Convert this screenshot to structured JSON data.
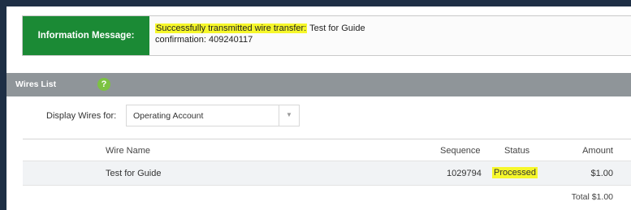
{
  "info": {
    "label": "Information Message:",
    "message_highlight": "Successfully transmitted wire transfer:",
    "message_rest": " Test for Guide",
    "confirmation": "confirmation: 409240117",
    "label_bg": "#1b8a35",
    "highlight_color": "#f6f72a"
  },
  "wires": {
    "title": "Wires List",
    "help_icon": "question-circle-icon",
    "filter_label": "Display Wires for:",
    "account_selected": "Operating Account"
  },
  "table": {
    "columns": [
      "Wire Name",
      "Sequence",
      "Status",
      "Amount"
    ],
    "rows": [
      {
        "name": "Test for Guide",
        "sequence": "1029794",
        "status": "Processed",
        "amount": "$1.00"
      }
    ],
    "total": "Total $1.00"
  }
}
